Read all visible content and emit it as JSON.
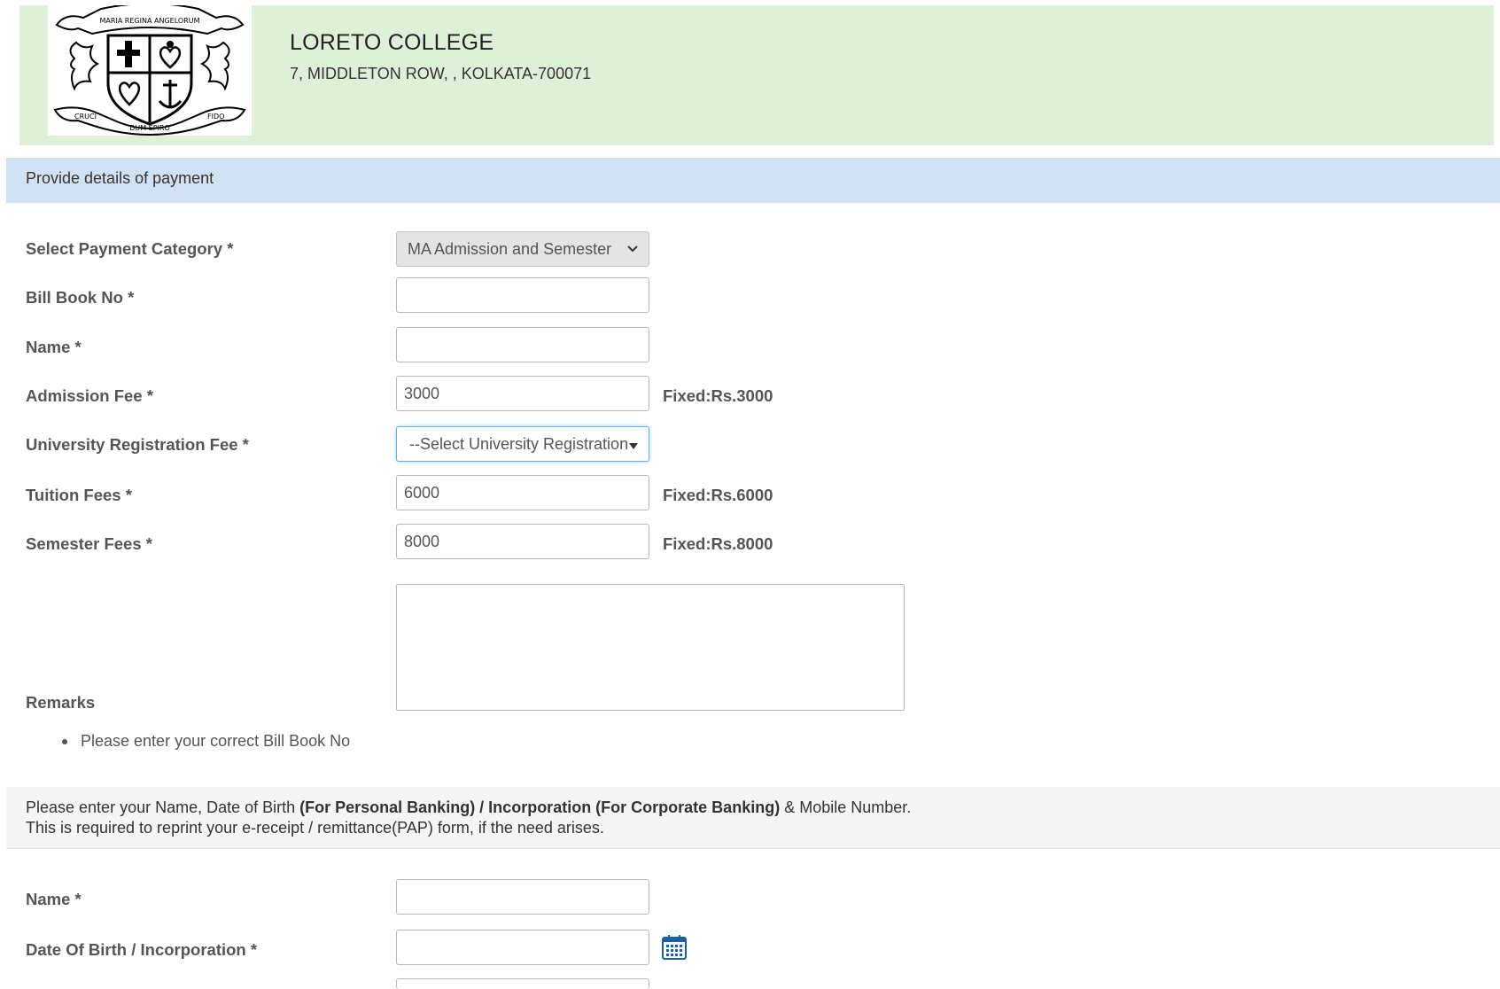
{
  "header": {
    "college_name": "LORETO COLLEGE",
    "address": "7, MIDDLETON ROW, , KOLKATA-700071",
    "logo": {
      "motto_top": "MARIA REGINA ANGELORUM",
      "motto_left": "CRUCI",
      "motto_center": "DUM SPIRO",
      "motto_right": "FIDO"
    }
  },
  "payment_section": {
    "heading": "Provide details of payment",
    "fields": {
      "category": {
        "label": "Select Payment Category *",
        "selected": "MA Admission and Semester"
      },
      "bill_book": {
        "label": "Bill Book No *",
        "value": ""
      },
      "name": {
        "label": "Name *",
        "value": ""
      },
      "admission_fee": {
        "label": "Admission Fee *",
        "value": "3000",
        "note": "Fixed:Rs.3000"
      },
      "univ_reg_fee": {
        "label": "University Registration Fee *",
        "selected": "--Select University Registration"
      },
      "tuition_fees": {
        "label": "Tuition Fees *",
        "value": "6000",
        "note": "Fixed:Rs.6000"
      },
      "semester_fees": {
        "label": "Semester Fees *",
        "value": "8000",
        "note": "Fixed:Rs.8000"
      },
      "remarks": {
        "label": "Remarks",
        "value": ""
      }
    },
    "notes": [
      "Please enter your correct Bill Book No"
    ]
  },
  "reprint_info": {
    "line1_pre": "Please enter your Name, Date of Birth ",
    "line1_bold": "(For Personal Banking) / Incorporation (For Corporate Banking)",
    "line1_post": " & Mobile Number.",
    "line2": "This is required to reprint your e-receipt / remittance(PAP) form, if the need arises."
  },
  "personal_section": {
    "name": {
      "label": "Name *",
      "value": ""
    },
    "dob": {
      "label": "Date Of Birth / Incorporation *",
      "value": "",
      "icon": "calendar-icon"
    }
  },
  "colors": {
    "header_bg": "#dff0d8",
    "panel_heading_bg": "#d1e3f2",
    "info_bg": "#f5f5f5",
    "focus_border": "#66afe9",
    "calendar_blue": "#1b5fa7"
  }
}
